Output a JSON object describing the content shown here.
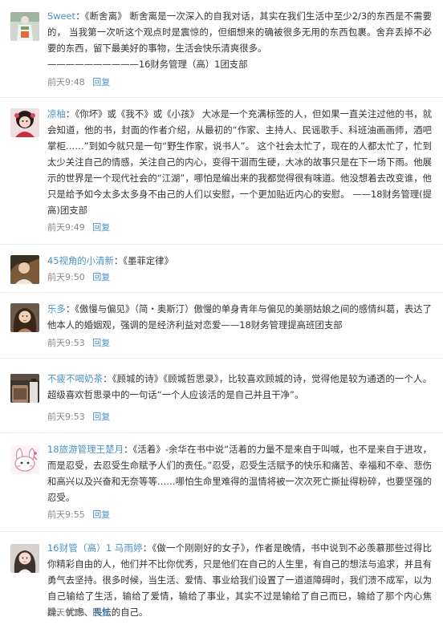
{
  "comments": [
    {
      "user": "Sweet",
      "separator": "：",
      "body": "《断舍离》 断舍离是一次深入的自我对话，其实在我们生活中至少2/3的东西是不需要的， 当我第一次听这个观点时是震惊的，但细想来的确被很多无用的东西包裹。舍弃丢掉不必要的东西，留下最美好的事物，生活会快乐清爽很多。\n——————————16财务管理（高）1团支部",
      "time": "前天9:48",
      "reply": "回复"
    },
    {
      "user": "凉柚",
      "separator": "：",
      "body": "《你坏》或《我不》或《小孩》 大冰是一个充满标签的人，但如果一直关注过他的书，就会知道，他的书，封面的作者介绍，从最初的“作家、主持人、民谣歌手、科班油画画师，酒吧掌柜……”到如今就只是一句“野生作家，说书人”。 这个社会太忙了，现在的人都太忙了，忙到太少关注自己的情感，关注自己的内心，变得干涸而生硬，大冰的故事只是在下一场下雨。他展示的世界是一个现代社会的“江湖”，哪怕是编出来的我都觉得很有味道。他没想着去改变谁，他只是给予如今太多太多身不由己的人们以安慰，一个更加贴近内心的安慰。 ——18财务管理(提高)团支部",
      "time": "前天9:49",
      "reply": "回复"
    },
    {
      "user": "45视角的小清新",
      "separator": "：",
      "body": "《墨菲定律》",
      "time": "前天9:50",
      "reply": "回复"
    },
    {
      "user": "乐多",
      "separator": "：",
      "body": "《傲慢与偏见》（简・奥斯汀）傲慢的单身青年与偏见的美丽姑娘之间的感情纠葛，表达了他本人的婚姻观，强调的是经济利益对恋爱——18财务管理提高班团支部",
      "time": "前天9:53",
      "reply": "回复"
    },
    {
      "user": "不疲不喝奶茶",
      "separator": "：",
      "body": "《顾城的诗》《顾城哲思录》，比较喜欢顾城的诗，觉得他是较为通透的一个人。超级喜欢哲思录中的一句话“一个人应该活的是自己并且干净”。",
      "time": "前天9:53",
      "reply": "回复"
    },
    {
      "user": "18旅游管理王楚月",
      "separator": "：",
      "body": "《活着》-余华在书中说“活着的力量不是来自于叫喊，也不是来自于进攻，而是忍受，去忍受生命赋予人们的责任。”忍受，忍受生活赋予的快乐和痛苦、幸福和不幸、悲伤和高兴以及兴奋和无奈等等……哪怕生命里难得的温情将被一次次死亡撕扯得粉碎，也要坚强的忍受。",
      "time": "前天9:55",
      "reply": "回复"
    },
    {
      "user": "16财管（高）1 马雨婷",
      "separator": "：",
      "body": "《做一个刚刚好的女子》，作者是晚情，书中说到不必羡慕那些过得比你精彩自由的人，他们并不比你优秀，只是他们在自己的人生里，有自己的想法与追求，并且有勇气去坚持。很多时候，当生活、爱情、事业给我们设置了一道道障碍时，我们溃不成军，以为自己输给了生活，输给了爱情，输给了事业，其实不过是输给了自己而已，输给了那个内心焦躁、忧虑、畏怯的自己。",
      "time": "前天9:56",
      "reply": "回复"
    }
  ]
}
